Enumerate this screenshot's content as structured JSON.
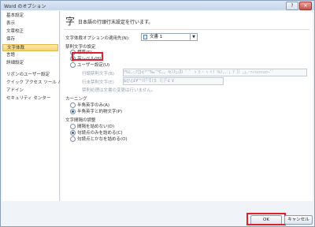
{
  "window": {
    "title": "Word のオプション",
    "help_glyph": "?",
    "close_glyph": "✕"
  },
  "sidebar": {
    "items": [
      {
        "label": "基本設定",
        "selected": false
      },
      {
        "label": "表示",
        "selected": false
      },
      {
        "label": "文章校正",
        "selected": false
      },
      {
        "label": "保存",
        "selected": false
      },
      {
        "label": "文字体裁",
        "selected": true
      },
      {
        "label": "言語",
        "selected": false
      },
      {
        "label": "詳細設定",
        "selected": false
      },
      {
        "label": "リボンのユーザー設定",
        "selected": false
      },
      {
        "label": "クイック アクセス ツール バー",
        "selected": false
      },
      {
        "label": "アドイン",
        "selected": false
      },
      {
        "label": "セキュリティ センター",
        "selected": false
      }
    ]
  },
  "header": {
    "icon_glyph": "字",
    "text": "日本語の行頭行末設定を行います。"
  },
  "scope": {
    "label": "文字体裁オプションの適用先(N):",
    "value": "文書 1"
  },
  "kinsoku": {
    "label": "禁則文字の設定",
    "options": [
      {
        "label": "標準(S)",
        "checked": false,
        "disabled": false
      },
      {
        "label": "高レベル(H)",
        "checked": true,
        "disabled": false
      },
      {
        "label": "ユーザー設定(U)",
        "checked": false,
        "disabled": false
      }
    ],
    "start_label": "行頭禁則文字(B)",
    "start_value": "!%),.:;?]}¢°’”‰′″℃、。々〉》」』】〕゛゜ゝゞ・ヽヾ！％），．：；？］｝｡｣､･ｧｨｩｪｫｬｭｮｯｰﾞﾟ",
    "end_label": "行末禁則文字(E)",
    "end_value": "$([\\{£¥‘“〈《「『【〔＄（［｛｢￡￥",
    "note": "禁則処理は文書の変更は行いません。"
  },
  "kerning": {
    "label": "カーニング",
    "options": [
      {
        "label": "半角英字のみ(A)",
        "checked": false
      },
      {
        "label": "半角英字と約物文字(P)",
        "checked": true
      }
    ]
  },
  "spacing": {
    "label": "文字間隔の調整",
    "options": [
      {
        "label": "間隔を詰めない(D)",
        "checked": false
      },
      {
        "label": "句読点のみを詰める(C)",
        "checked": true
      },
      {
        "label": "句読点とかなを詰める(O)",
        "checked": false
      }
    ]
  },
  "buttons": {
    "ok": "OK",
    "cancel": "キャンセル"
  },
  "colors": {
    "highlight": "#e0202a",
    "selected_bg": "#f8d272"
  }
}
